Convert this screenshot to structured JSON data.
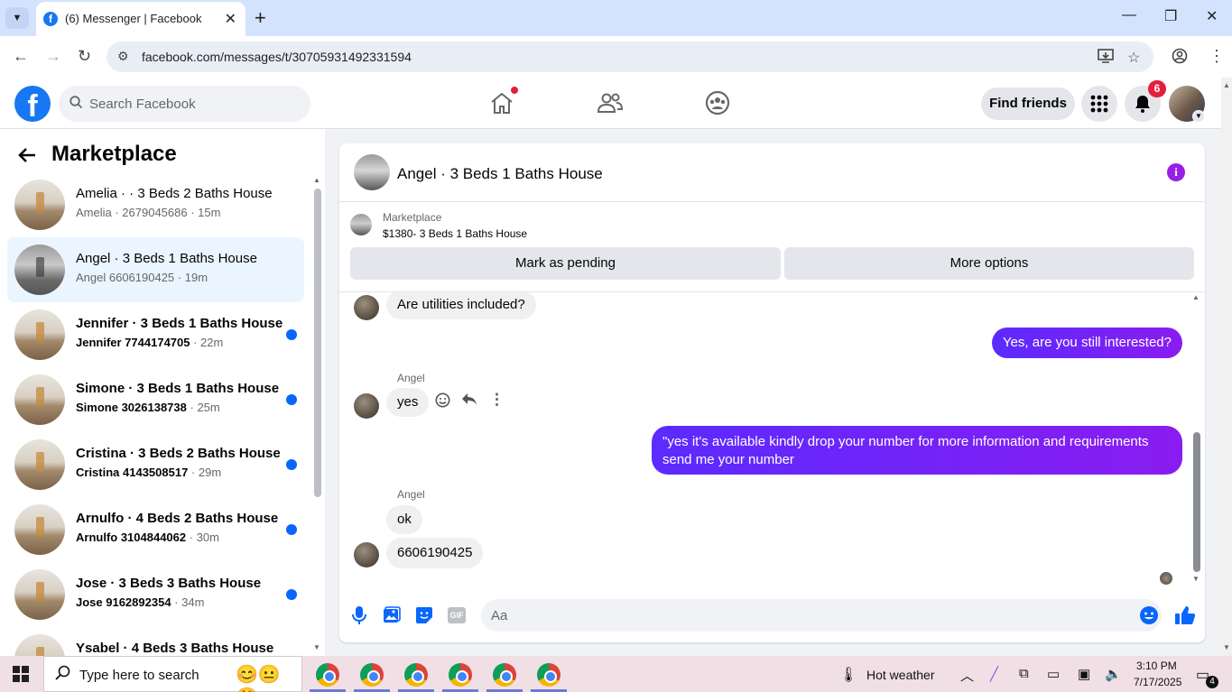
{
  "browser": {
    "tab_title": "(6) Messenger | Facebook",
    "url": "facebook.com/messages/t/30705931492331594",
    "new_tab_symbol": "+"
  },
  "facebook": {
    "search_placeholder": "Search Facebook",
    "find_friends_label": "Find friends",
    "notification_count": "6",
    "home_has_alert": true
  },
  "sidebar": {
    "title": "Marketplace",
    "conversations": [
      {
        "name": "Amelia · · 3 Beds 2 Baths House",
        "sub_name": "Amelia · 2679045686",
        "time": "15m",
        "unread": false,
        "active": false
      },
      {
        "name": "Angel · 3 Beds 1 Baths House",
        "sub_name": "Angel 6606190425",
        "time": "19m",
        "unread": false,
        "active": true
      },
      {
        "name": "Jennifer · 3 Beds 1 Baths House",
        "sub_name": "Jennifer 7744174705",
        "time": "22m",
        "unread": true,
        "active": false
      },
      {
        "name": "Simone · 3 Beds 1 Baths House",
        "sub_name": "Simone 3026138738",
        "time": "25m",
        "unread": true,
        "active": false
      },
      {
        "name": "Cristina · 3 Beds 2 Baths House",
        "sub_name": "Cristina 4143508517",
        "time": "29m",
        "unread": true,
        "active": false
      },
      {
        "name": "Arnulfo · 4 Beds 2 Baths House",
        "sub_name": "Arnulfo 3104844062",
        "time": "30m",
        "unread": true,
        "active": false
      },
      {
        "name": "Jose · 3 Beds 3 Baths House",
        "sub_name": "Jose 9162892354",
        "time": "34m",
        "unread": true,
        "active": false
      },
      {
        "name": "Ysabel · 4 Beds 3 Baths House",
        "sub_name": "",
        "time": "",
        "unread": true,
        "active": false
      }
    ]
  },
  "chat": {
    "title": "Angel · 3 Beds 1 Baths House",
    "marketplace_label": "Marketplace",
    "listing": "$1380- 3 Beds 1 Baths House",
    "mark_pending_label": "Mark as pending",
    "more_options_label": "More options",
    "messages": {
      "m1": "Are utilities included?",
      "m2": "Yes, are you still interested?",
      "sender_a": "Angel",
      "m3": "yes",
      "m4_line1": "\"yes it's available kindly drop your number for more information and requirements",
      "m4_line2": "send me your number",
      "sender_b": "Angel",
      "m5": "ok",
      "m6": "6606190425"
    },
    "composer_placeholder": "Aa",
    "gif_label": "GIF"
  },
  "taskbar": {
    "search_placeholder": "Type here to search",
    "weather": "Hot weather",
    "time": "3:10 PM",
    "date": "7/17/2025",
    "notification_count": "4"
  },
  "colors": {
    "facebook_blue": "#1877f2",
    "outgoing_bubble": "#7b22f4",
    "unread_dot": "#0866ff",
    "badge_red": "#e41e3f"
  },
  "icons": [
    "chevron-down-icon",
    "close-icon",
    "back-arrow-icon",
    "forward-arrow-icon",
    "reload-icon",
    "site-settings-icon",
    "install-icon",
    "star-icon",
    "account-icon",
    "menu-icon",
    "search-icon",
    "home-icon",
    "friends-icon",
    "groups-icon",
    "apps-grid-icon",
    "bell-icon",
    "info-icon",
    "smile-icon",
    "reply-icon",
    "more-icon",
    "mic-icon",
    "photo-icon",
    "sticker-icon",
    "gif-icon",
    "emoji-icon",
    "like-icon",
    "windows-icon",
    "chrome-icon"
  ]
}
